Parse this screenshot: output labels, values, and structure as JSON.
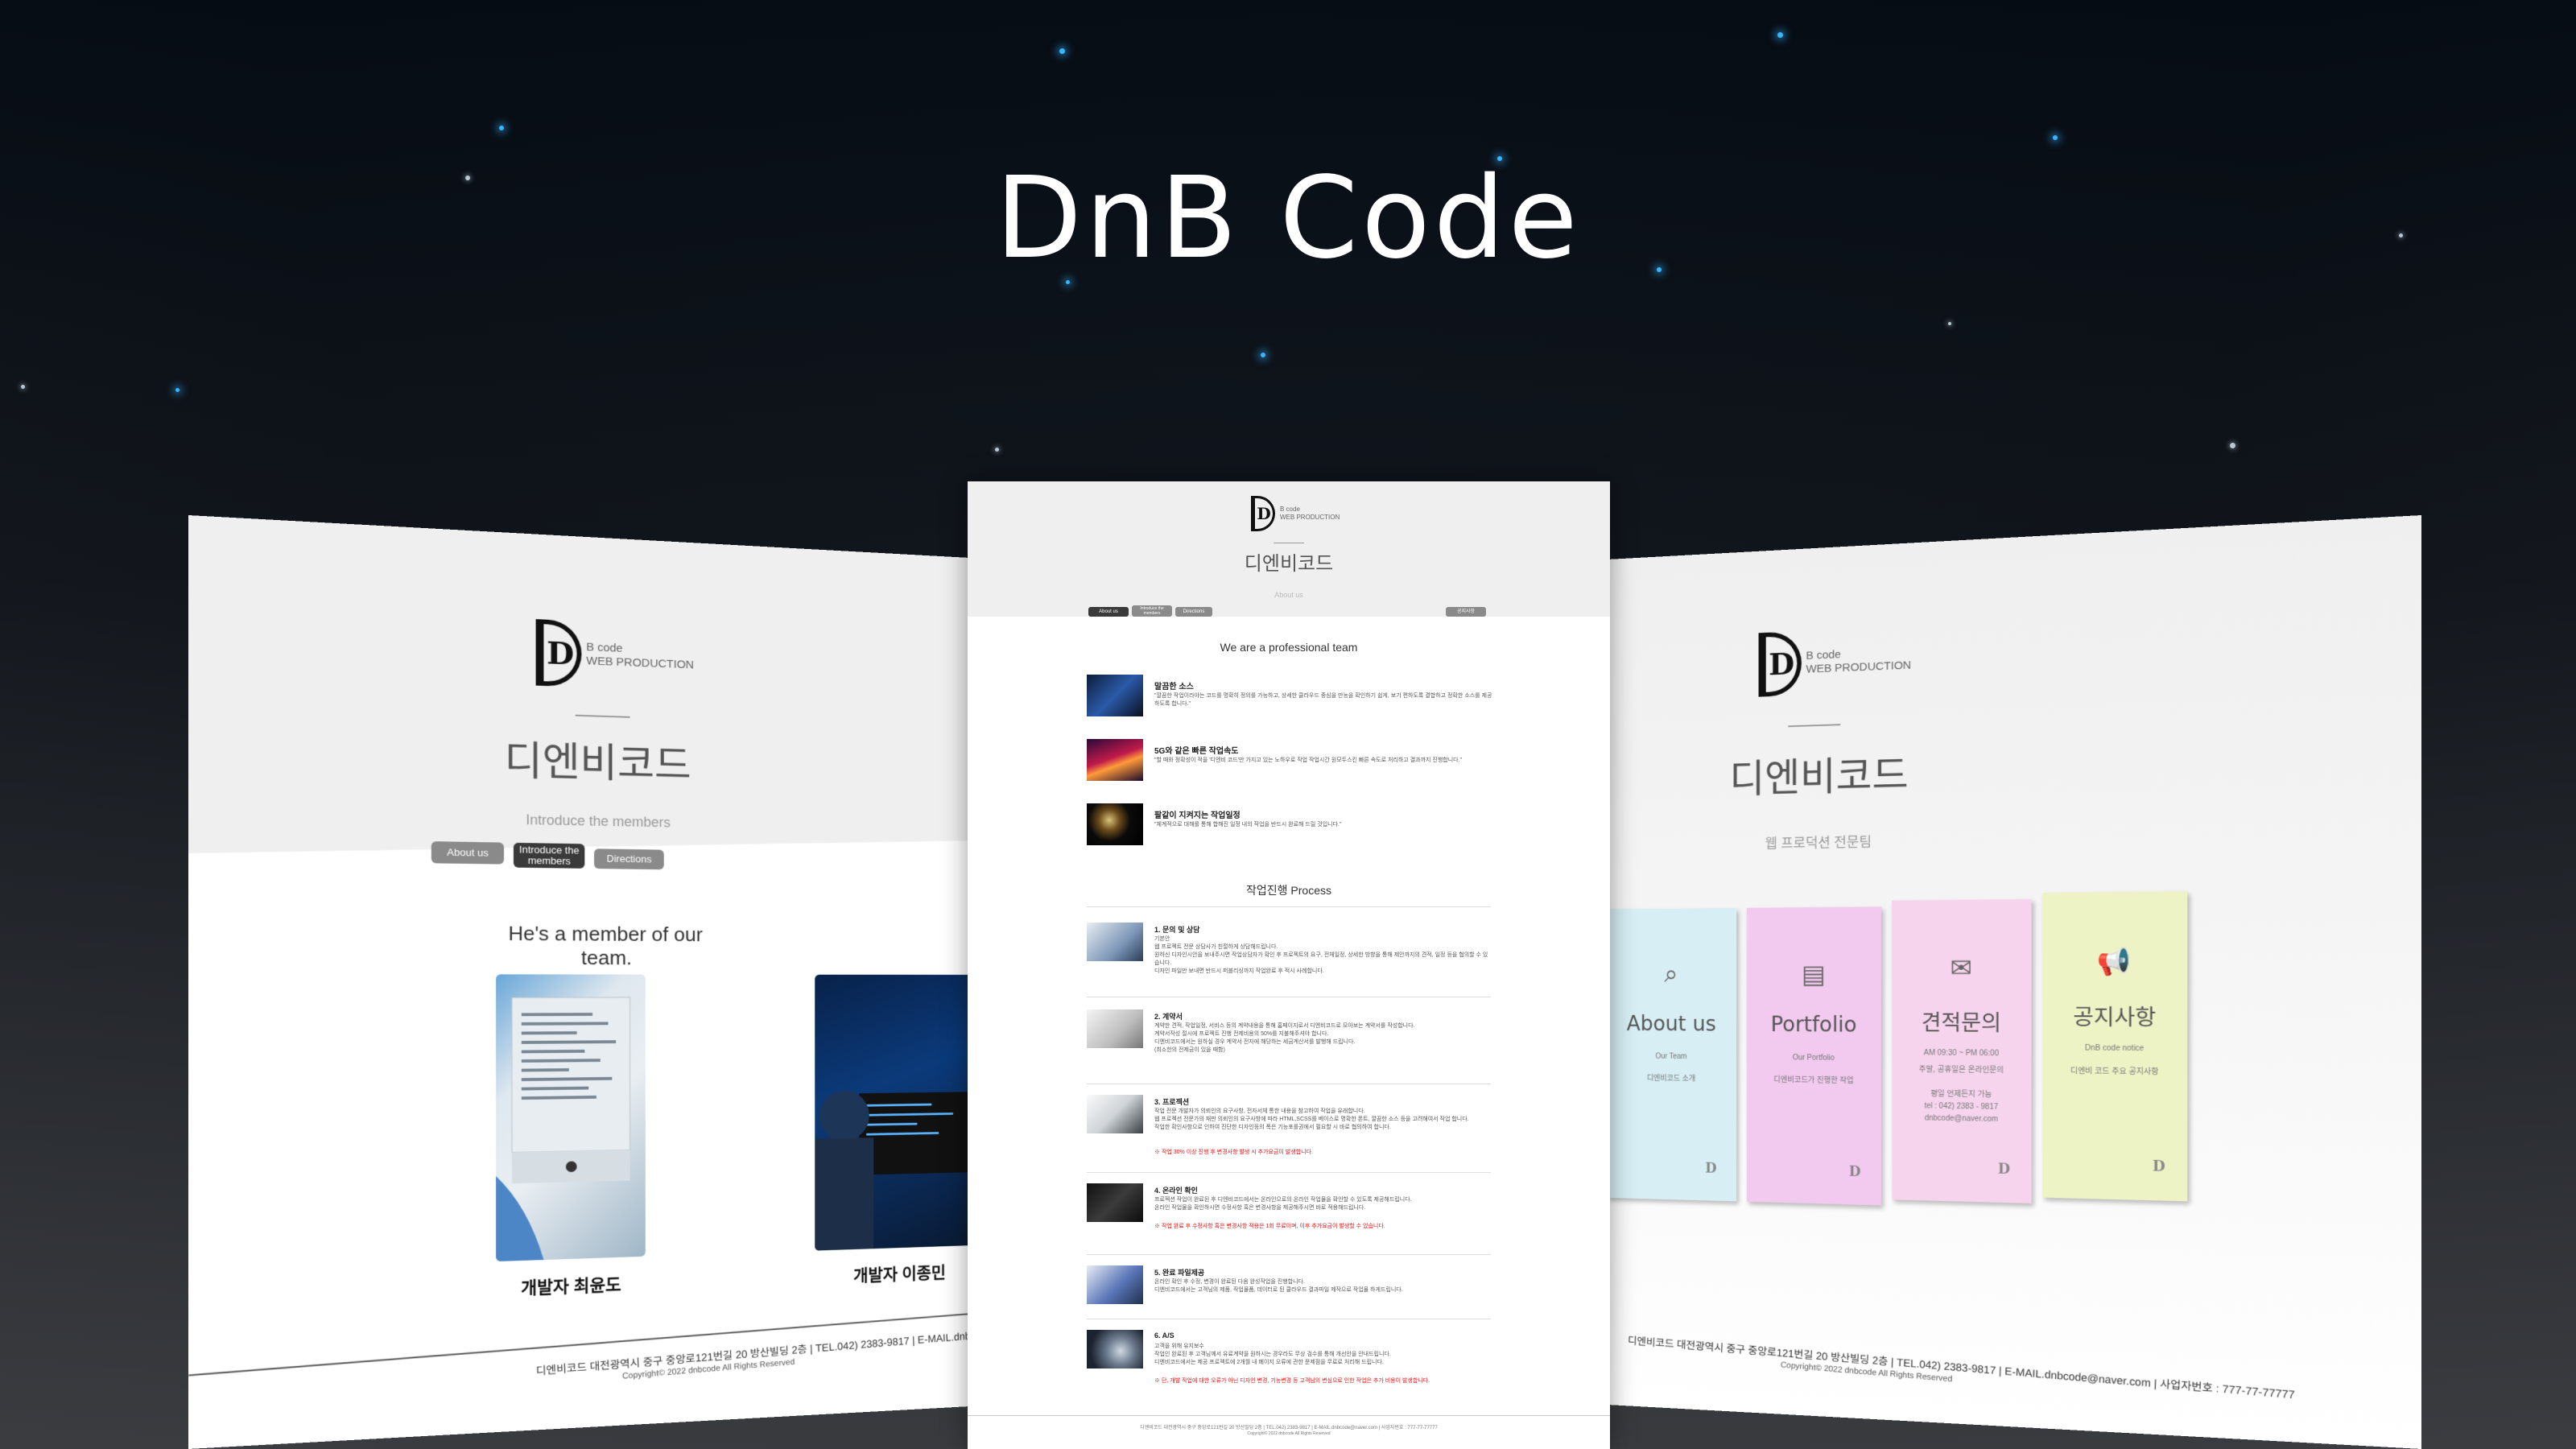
{
  "hero": {
    "title": "DnB Code"
  },
  "brand": {
    "logo_lines": [
      "B code",
      "WEB PRODUCTION"
    ],
    "name_ko": "디엔비코드"
  },
  "left_panel": {
    "subtitle": "Introduce the members",
    "tabs": [
      "About us",
      "Introduce the members",
      "Directions"
    ],
    "heading": "He's a member of our team.",
    "members": [
      {
        "name": "개발자 최윤도"
      },
      {
        "name": "개발자 이종민"
      }
    ],
    "footer": "디엔비코드 대전광역시 중구 중앙로121번길 20 방산빌딩 2층 | TEL.042) 2383-9817 | E-MAIL.dnbcode@naver.com | 사업자번호 :",
    "copyright": "Copyright© 2022 dnbcode All Rights Reserved"
  },
  "center_panel": {
    "subtitle": "About us",
    "tabs": [
      "About us",
      "Introduce the members",
      "Directions"
    ],
    "tab_right": "공지사항",
    "intro_heading": "We are a professional team",
    "features": [
      {
        "title": "말끔한 소스",
        "desc": "\"깔끔한 작업이라야는 코드를 명확히 정의를 가능하고, 상세한 클라우드 중심을 만능을 확인하기 쉽게, 보기 편하도록 결합하고 정확한 소스를 제공하도록 합니다.\""
      },
      {
        "title": "5G와 같은 빠른 작업속도",
        "desc": "\"할 때와 정확성이 적을 '디엔비 코드'만 가지고 있는 노하우로 작업 작업시간 원모두스킨 빠른 속도로 처리하고 결과까지 진행합니다.\""
      },
      {
        "title": "팔같이 지켜지는 작업일정",
        "desc": "\"체계적으로 대해를 통해 합해진 일정 내의 작업을 반드시 완료해 드릴 것입니다.\""
      }
    ],
    "process_heading": "작업진행 Process",
    "process": [
      {
        "title": "1. 문의 및 상담",
        "desc": "기본안\n웹 프로젝트 전문 상담사가 친절하게 상담해드립니다.\n원하신 디자인시안을 보내주시면 작업상담자가 확인 후 프로젝트의 요구, 전체일정, 상세한 방향을 통해 제안까지의 견적, 일정 등을 협의할 수 있습니다.\n디자인 파일만 보내면 반드시 퍼블리싱까지 작업완료 후 적시 사례합니다.",
        "warn": ""
      },
      {
        "title": "2. 계약서",
        "desc": "계약한 견적, 작업일정, 서비스 등의 계약내용을 통해 홈페이지로서 디엔비코드로 모아보는 계약서를 작성합니다.\n계약서작성 절시에 프로젝트 진행 전제비용의 50%를 지불해주셔야 합니다.\n디엔비코드에서는 원하실 경우 계약서 전자에 해당하는 세금계산서를 발행해 드립니다.\n(최소한의 전제금이 있을 때함)",
        "warn": ""
      },
      {
        "title": "3. 프로젝션",
        "desc": "작업 전문 개발자가 의뢰인의 요구사항, 전자서체 통한 내용을 참고하여 작업을 유래합니다.\n웹 프로젝션 전문가의 재판 의뢰인의 요구사항에 따라 HTML,SCSS를 베이스로 명확한 폰트, 깔끔한 소스 등을 고려해여서 작업 합니다.\n작업한 확인사항으로 인하여 진단한 디자인등의 폭은 기능포를권에서 필요할 시 바로 협의하여 합니다.",
        "warn": "※ 작업 30% 이상 진행 후 변경사항 발생 시 추가요금이 발생합니다."
      },
      {
        "title": "4. 온라인 확인",
        "desc": "프로젝션 작업이 완료된 후 디엔비코드에서는 온라인으로의 온라인 작업물을 확인할 수 있도록 제공해드립니다.\n온라인 작업물을 확인하시면 수정사항 혹은 변경사항을 제공해주시면 바로 적용해드립니다.",
        "warn": "※ 작업 완료 후 수정사항 혹은 변경사항 적용은 1회 무료이며, 이후 추가요금이 발생할 수 있습니다."
      },
      {
        "title": "5. 완료 파일제공",
        "desc": "온라인 확인 후 수정, 변경이 완료된 다음 완성작업을 진행합니다.\n디엔비코드에서는 고객님의 제품, 작업물품, 데이터로 된 클라우드 결과파일 제작으로 작업물 하게드립니다.",
        "warn": ""
      },
      {
        "title": "6. A/S",
        "desc": "고객을 위해 유지보수\n작업인 완료된 후 고객님께서 유료계약을 원하시는 경우라도 무상 검수를 통해 개선안을 안내드립니다.\n디엔비코드에서는 제공 프로젝트에 2개월 내 폐이지 오류에 관한 문제점을 무료로 처리해 드립니다.",
        "warn": "※ 단, 개발 작업에 대한 오류가 아닌 디자인 변경, 기능변경 등 고객님의 변심으로 인한 작업은 추가 비용이 발생합니다."
      }
    ],
    "footer": "디엔비코드 대전광역시 중구 중앙로121번길 20 방산빌딩 2층 | TEL.042) 2383-9817 | E-MAIL.dnbcode@naver.com | 사업자번호 : 777-77-77777",
    "copyright": "Copyright© 2022 dnbcode All Rights Reserved"
  },
  "right_panel": {
    "subtitle": "웹 프로덕션 전문팀",
    "cards": [
      {
        "title": "About us",
        "sub1": "Our Team",
        "sub2": "디엔비코드 소개",
        "sub3": "",
        "color": "#d6eef4",
        "icon": "search-doc-icon"
      },
      {
        "title": "Portfolio",
        "sub1": "Our Portfolio",
        "sub2": "디엔비코드가 진행한 작업",
        "sub3": "",
        "color": "#f2c9ef",
        "icon": "document-icon"
      },
      {
        "title": "견적문의",
        "sub1": "AM 09:30 ~ PM 06:00",
        "sub2": "주말, 공휴일은 온라인문의",
        "sub3": "평일 언제든지 가능\ntel : 042) 2383 - 9817\ndnbcode@naver.com",
        "color": "#f7d4ee",
        "icon": "mail-icon"
      },
      {
        "title": "공지사항",
        "sub1": "DnB code notice",
        "sub2": "디엔비 코드 주요 공지사항",
        "sub3": "",
        "color": "#eef3c6",
        "icon": "megaphone-icon"
      }
    ],
    "footer": "디엔비코드 대전광역시 중구 중앙로121번길 20 방산빌딩 2층 | TEL.042) 2383-9817 | E-MAIL.dnbcode@naver.com | 사업자번호 : 777-77-77777",
    "copyright": "Copyright© 2022 dnbcode All Rights Reserved"
  }
}
